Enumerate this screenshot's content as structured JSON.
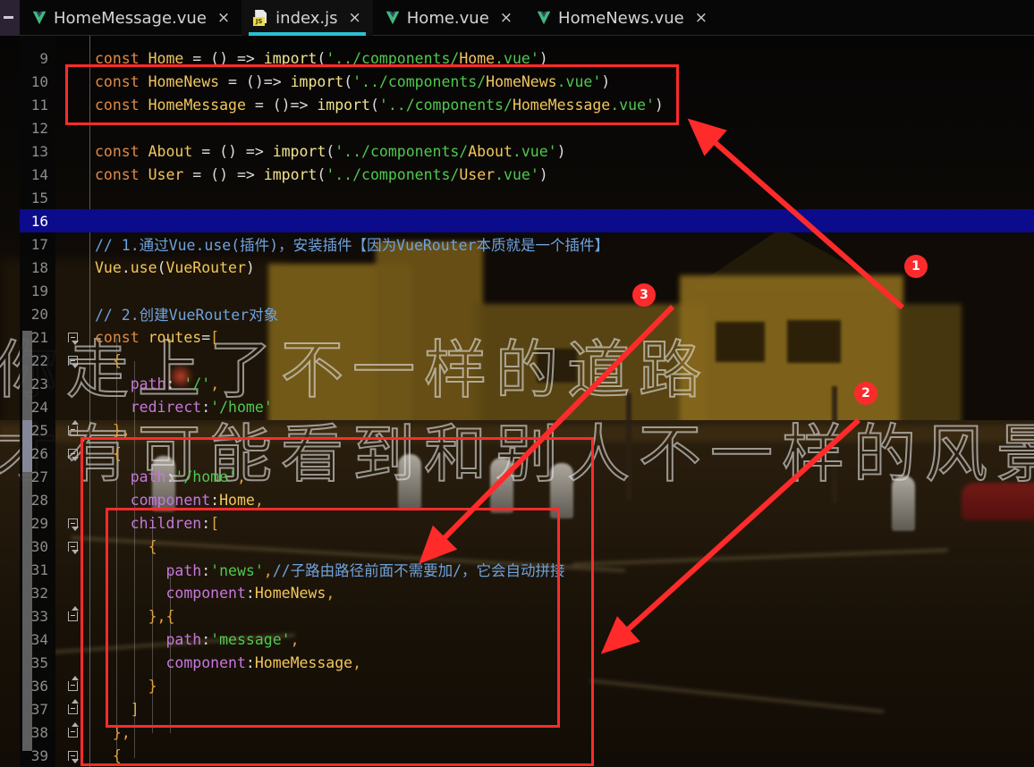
{
  "window": {
    "activity_strip_icon": "collapse-icon"
  },
  "tabs": [
    {
      "label": "HomeMessage.vue",
      "icon": "vue-file-icon",
      "close": "×",
      "active": false
    },
    {
      "label": "index.js",
      "icon": "js-file-icon",
      "close": "×",
      "active": true
    },
    {
      "label": "Home.vue",
      "icon": "vue-file-icon",
      "close": "×",
      "active": false
    },
    {
      "label": "HomeNews.vue",
      "icon": "vue-file-icon",
      "close": "×",
      "active": false
    }
  ],
  "editor": {
    "active_line": 16,
    "first_visible_line": 9,
    "lines": [
      {
        "no": "9",
        "text": "const Home = () => import('../components/Home.vue')"
      },
      {
        "no": "10",
        "text": "const HomeNews = ()=> import('../components/HomeNews.vue')"
      },
      {
        "no": "11",
        "text": "const HomeMessage = ()=> import('../components/HomeMessage.vue')"
      },
      {
        "no": "12",
        "text": ""
      },
      {
        "no": "13",
        "text": "const About = () => import('../components/About.vue')"
      },
      {
        "no": "14",
        "text": "const User = () => import('../components/User.vue')"
      },
      {
        "no": "15",
        "text": ""
      },
      {
        "no": "16",
        "text": ""
      },
      {
        "no": "17",
        "text": "// 1.通过Vue.use(插件)，安装插件【因为VueRouter本质就是一个插件】"
      },
      {
        "no": "18",
        "text": "Vue.use(VueRouter)"
      },
      {
        "no": "19",
        "text": ""
      },
      {
        "no": "20",
        "text": "// 2.创建VueRouter对象"
      },
      {
        "no": "21",
        "text": "const routes=["
      },
      {
        "no": "22",
        "text": "  {"
      },
      {
        "no": "23",
        "text": "    path: '/',"
      },
      {
        "no": "24",
        "text": "    redirect:'/home'"
      },
      {
        "no": "25",
        "text": "  },"
      },
      {
        "no": "26",
        "text": "  {"
      },
      {
        "no": "27",
        "text": "    path:'/home',"
      },
      {
        "no": "28",
        "text": "    component:Home,"
      },
      {
        "no": "29",
        "text": "    children:["
      },
      {
        "no": "30",
        "text": "      {"
      },
      {
        "no": "31",
        "text": "        path:'news',//子路由路径前面不需要加/，它会自动拼接"
      },
      {
        "no": "32",
        "text": "        component:HomeNews,"
      },
      {
        "no": "33",
        "text": "      },{"
      },
      {
        "no": "34",
        "text": "        path:'message',"
      },
      {
        "no": "35",
        "text": "        component:HomeMessage,"
      },
      {
        "no": "36",
        "text": "      }"
      },
      {
        "no": "37",
        "text": "    ]"
      },
      {
        "no": "38",
        "text": "  },"
      },
      {
        "no": "39",
        "text": "  {"
      }
    ]
  },
  "wallpaper": {
    "quote_line1": "你走上了不一样的道路",
    "quote_line2": "才有可能看到和别人不一样的风景"
  },
  "annotations": {
    "accent_color": "#ff2b2b",
    "markers": [
      {
        "id": "1",
        "label": "1"
      },
      {
        "id": "2",
        "label": "2"
      },
      {
        "id": "3",
        "label": "3"
      }
    ]
  }
}
